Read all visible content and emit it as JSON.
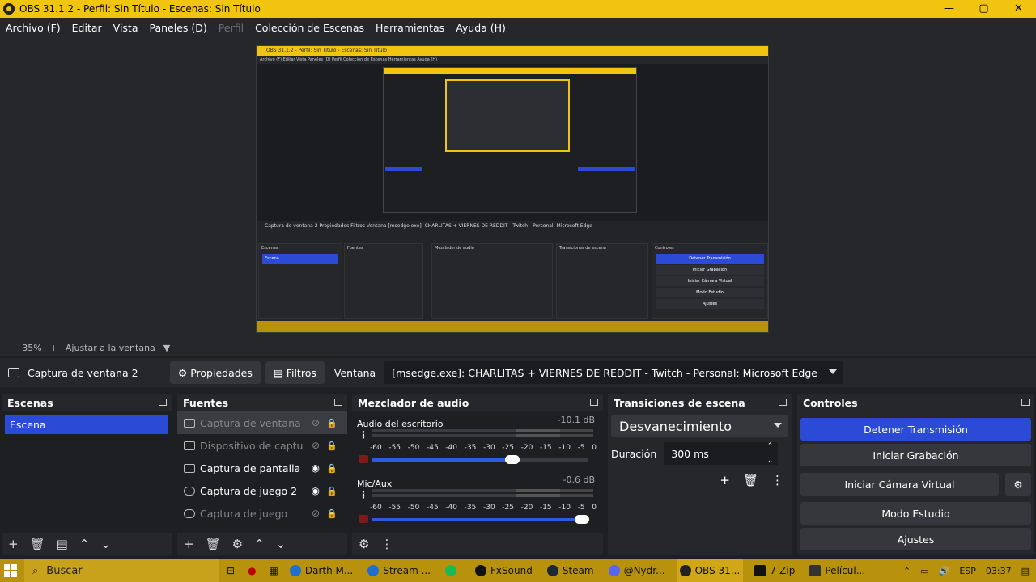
{
  "window": {
    "title": "OBS 31.1.2 - Perfil: Sin Título - Escenas: Sin Título",
    "minimize": "—",
    "maximize": "▢",
    "close": "✕"
  },
  "menu": [
    "Archivo (F)",
    "Editar",
    "Vista",
    "Paneles (D)",
    "Perfil",
    "Colección de Escenas",
    "Herramientas",
    "Ayuda (H)"
  ],
  "preview_nested": {
    "title": "OBS 31.1.2 - Perfil: Sin Título - Escenas: Sin Título",
    "menu": "Archivo (F)   Editar   Vista   Paneles (D)   Perfil   Colección de Escenas   Herramientas   Ayuda (H)",
    "source_row": "Captura de ventana 2     Propiedades     Filtros     Ventana   [msedge.exe]: CHARLITAS + VIERNES DE REDDIT - Twitch - Personal: Microsoft Edge",
    "controls": [
      "Detener Transmisión",
      "Iniciar Grabación",
      "Iniciar Cámara Virtual",
      "Modo Estudio",
      "Ajustes"
    ]
  },
  "zoom": {
    "minus": "−",
    "value": "35%",
    "plus": "+",
    "fit_label": "Ajustar a la ventana"
  },
  "source_toolbar": {
    "current_source": "Captura de ventana 2",
    "properties": "Propiedades",
    "filters": "Filtros",
    "window_label": "Ventana",
    "window_value": "[msedge.exe]: CHARLITAS + VIERNES DE REDDIT - Twitch - Personal: Microsoft Edge"
  },
  "scenes": {
    "title": "Escenas",
    "items": [
      "Escena"
    ]
  },
  "sources": {
    "title": "Fuentes",
    "items": [
      {
        "label": "Captura de ventana",
        "icon": "window-icon",
        "visible": false,
        "selected": true
      },
      {
        "label": "Dispositivo de captu",
        "icon": "camera-icon",
        "visible": false,
        "selected": false
      },
      {
        "label": "Captura de pantalla",
        "icon": "monitor-icon",
        "visible": true,
        "selected": false
      },
      {
        "label": "Captura de juego 2",
        "icon": "gamepad-icon",
        "visible": true,
        "selected": false
      },
      {
        "label": "Captura de juego",
        "icon": "gamepad-icon",
        "visible": false,
        "selected": false
      }
    ]
  },
  "mixer": {
    "title": "Mezclador de audio",
    "ticks": [
      "-60",
      "-55",
      "-50",
      "-45",
      "-40",
      "-35",
      "-30",
      "-25",
      "-20",
      "-15",
      "-10",
      "-5",
      "0"
    ],
    "channels": [
      {
        "name": "Audio del escritorio",
        "db": "-10.1 dB",
        "volume": 0.65
      },
      {
        "name": "Mic/Aux",
        "db": "-0.6 dB",
        "volume": 0.97
      }
    ]
  },
  "transitions": {
    "title": "Transiciones de escena",
    "selected": "Desvanecimiento",
    "duration_label": "Duración",
    "duration_value": "300 ms"
  },
  "controls": {
    "title": "Controles",
    "stop_stream": "Detener Transmisión",
    "start_recording": "Iniciar Grabación",
    "start_virtual_cam": "Iniciar Cámara Virtual",
    "studio_mode": "Modo Estudio",
    "settings": "Ajustes"
  },
  "taskbar": {
    "search_placeholder": "Buscar",
    "apps": [
      {
        "label": "Darth M...",
        "color": "#1f6fd1"
      },
      {
        "label": "Stream ...",
        "color": "#1f6fd1"
      },
      {
        "label": "",
        "color": "#1db954"
      },
      {
        "label": "FxSound",
        "color": "#111111"
      },
      {
        "label": "Steam",
        "color": "#1b2838"
      },
      {
        "label": "@Nydr...",
        "color": "#5865f2"
      },
      {
        "label": "OBS 31...",
        "color": "#222222"
      },
      {
        "label": "7-Zip",
        "color": "#111111"
      },
      {
        "label": "Películ...",
        "color": "#333333"
      }
    ],
    "lang": "ESP",
    "time": "03:37"
  }
}
